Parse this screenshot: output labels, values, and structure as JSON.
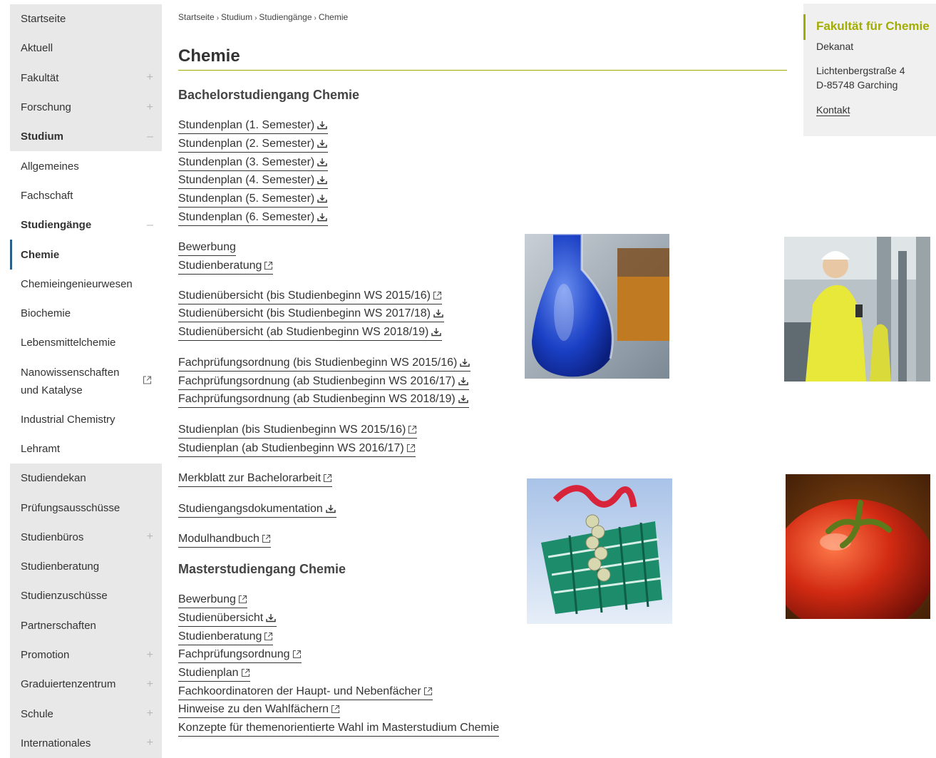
{
  "sidebar": {
    "items": [
      {
        "label": "Startseite",
        "sign": ""
      },
      {
        "label": "Aktuell",
        "sign": ""
      },
      {
        "label": "Fakultät",
        "sign": "+"
      },
      {
        "label": "Forschung",
        "sign": "+"
      },
      {
        "label": "Studium",
        "sign": "–"
      },
      {
        "label": "Allgemeines",
        "sign": ""
      },
      {
        "label": "Fachschaft",
        "sign": ""
      },
      {
        "label": "Studiengänge",
        "sign": "–"
      },
      {
        "label": "Chemie",
        "sign": ""
      },
      {
        "label": "Chemieingenieurwesen",
        "sign": ""
      },
      {
        "label": "Biochemie",
        "sign": ""
      },
      {
        "label": "Lebensmittelchemie",
        "sign": ""
      },
      {
        "label": "Nanowissenschaften und Katalyse",
        "sign": ""
      },
      {
        "label": "Industrial Chemistry",
        "sign": ""
      },
      {
        "label": "Lehramt",
        "sign": ""
      },
      {
        "label": "Studiendekan",
        "sign": ""
      },
      {
        "label": "Prüfungsausschüsse",
        "sign": ""
      },
      {
        "label": "Studienbüros",
        "sign": "+"
      },
      {
        "label": "Studienberatung",
        "sign": ""
      },
      {
        "label": "Studienzuschüsse",
        "sign": ""
      },
      {
        "label": "Partnerschaften",
        "sign": ""
      },
      {
        "label": "Promotion",
        "sign": "+"
      },
      {
        "label": "Graduiertenzentrum",
        "sign": "+"
      },
      {
        "label": "Schule",
        "sign": "+"
      },
      {
        "label": "Internationales",
        "sign": "+"
      }
    ]
  },
  "breadcrumb": [
    "Startseite",
    "Studium",
    "Studiengänge",
    "Chemie"
  ],
  "breadcrumb_separator": "›",
  "page_title": "Chemie",
  "bachelor": {
    "heading": "Bachelorstudiengang Chemie",
    "links": [
      {
        "label": "Stundenplan (1. Semester)",
        "icon": "download-icon"
      },
      {
        "label": "Stundenplan (2. Semester)",
        "icon": "download-icon"
      },
      {
        "label": "Stundenplan (3. Semester)",
        "icon": "download-icon"
      },
      {
        "label": "Stundenplan (4. Semester)",
        "icon": "download-icon"
      },
      {
        "label": "Stundenplan (5. Semester)",
        "icon": "download-icon"
      },
      {
        "label": "Stundenplan (6. Semester)",
        "icon": "download-icon"
      },
      {
        "label": "Bewerbung",
        "icon": ""
      },
      {
        "label": "Studienberatung",
        "icon": "external-link-icon"
      },
      {
        "label": "Studienübersicht (bis Studienbeginn WS 2015/16)",
        "icon": "external-link-icon"
      },
      {
        "label": "Studienübersicht (bis Studienbeginn WS 2017/18)",
        "icon": "download-icon"
      },
      {
        "label": "Studienübersicht (ab Studienbeginn WS 2018/19)",
        "icon": "download-icon"
      },
      {
        "label": "Fachprüfungsordnung (bis Studienbeginn WS 2015/16)",
        "icon": "download-icon"
      },
      {
        "label": "Fachprüfungsordnung (ab Studienbeginn WS 2016/17)",
        "icon": "download-icon"
      },
      {
        "label": "Fachprüfungsordnung (ab Studienbeginn WS 2018/19)",
        "icon": "download-icon"
      },
      {
        "label": "Studienplan (bis Studienbeginn WS 2015/16)",
        "icon": "external-link-icon"
      },
      {
        "label": "Studienplan (ab Studienbeginn WS 2016/17)",
        "icon": "external-link-icon"
      },
      {
        "label": "Merkblatt zur Bachelorarbeit",
        "icon": "external-link-icon"
      },
      {
        "label": "Studiengangsdokumentation",
        "icon": "download-icon"
      },
      {
        "label": "Modulhandbuch",
        "icon": "external-link-icon"
      }
    ]
  },
  "master": {
    "heading": "Masterstudiengang Chemie",
    "links": [
      {
        "label": "Bewerbung",
        "icon": "external-link-icon"
      },
      {
        "label": "Studienübersicht",
        "icon": "download-icon"
      },
      {
        "label": "Studienberatung",
        "icon": "external-link-icon"
      },
      {
        "label": "Fachprüfungsordnung",
        "icon": "external-link-icon"
      },
      {
        "label": "Studienplan",
        "icon": "external-link-icon"
      },
      {
        "label": "Fachkoordinatoren der Haupt- und Nebenfächer",
        "icon": "external-link-icon"
      },
      {
        "label": "Hinweise zu den Wahlfächern",
        "icon": "external-link-icon"
      },
      {
        "label": "Konzepte für themenorientierte Wahl im Masterstudium Chemie",
        "icon": ""
      }
    ]
  },
  "info_box": {
    "title": "Fakultät für Chemie",
    "dept": "Dekanat",
    "street": "Lichtenbergstraße 4",
    "city": "D-85748 Garching",
    "contact": "Kontakt"
  },
  "colors": {
    "accent": "#a2ad00",
    "active_marker": "#2c5f8a",
    "sidebar_grey": "#e8e8e8",
    "text": "#333333"
  }
}
